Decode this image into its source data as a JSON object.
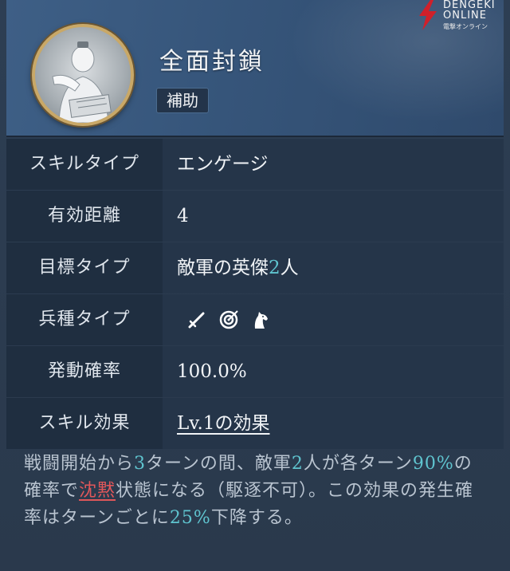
{
  "header": {
    "title": "全面封鎖",
    "badge": "補助"
  },
  "watermark": {
    "line1": "DENGEKI",
    "line2": "ONLINE",
    "sub": "電撃オンライン"
  },
  "rows": [
    {
      "label": "スキルタイプ",
      "value": "エンゲージ"
    },
    {
      "label": "有効距離",
      "value": "4"
    },
    {
      "label": "目標タイプ",
      "value_prefix": "敵軍の英傑",
      "value_num": "2",
      "value_suffix": "人"
    },
    {
      "label": "兵種タイプ",
      "icons": [
        "sword-icon",
        "bow-target-icon",
        "horse-icon"
      ]
    },
    {
      "label": "発動確率",
      "value": "100.0%"
    },
    {
      "label": "スキル効果",
      "value": "Lv.1の効果"
    }
  ],
  "description": {
    "p1": "戦闘開始から",
    "n1": "3",
    "p2": "ターンの間、敵軍",
    "n2": "2",
    "p3": "人が各ターン",
    "n3": "90%",
    "p4": "の確率で",
    "status": "沈黙",
    "p5": "状態になる（駆逐不可）。この効果の発生確率はターンごとに",
    "n4": "25%",
    "p6": "下降する。"
  },
  "colors": {
    "accent": "#5fc4cf",
    "status_red": "#e0575a",
    "header_blue": "#3e5f86",
    "label_bg": "#1f2e40",
    "row_bg": "#253549"
  }
}
